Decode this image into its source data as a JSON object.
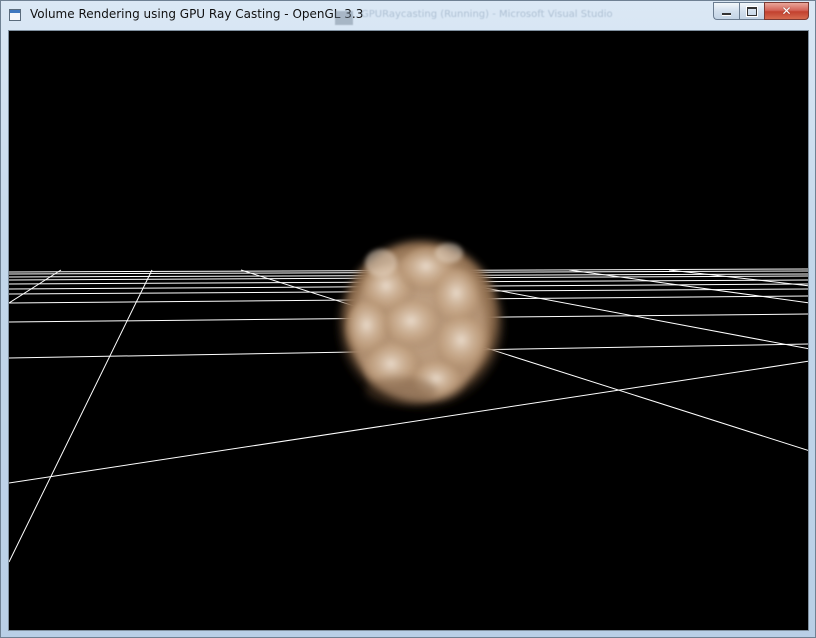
{
  "window": {
    "title": "Volume Rendering using GPU Ray Casting - OpenGL 3.3",
    "background_window_title": "GPURaycasting (Running) - Microsoft Visual Studio"
  },
  "scene": {
    "background_color": "#000000",
    "grid_color": "#ffffff",
    "volume_color": "#c9aa8a",
    "volume_shadow_color": "#7a5a3f",
    "volume_highlight_color": "#eedfce"
  },
  "icons": {
    "app": "window-icon",
    "minimize": "minimize-icon",
    "maximize": "maximize-icon",
    "close": "close-icon"
  }
}
